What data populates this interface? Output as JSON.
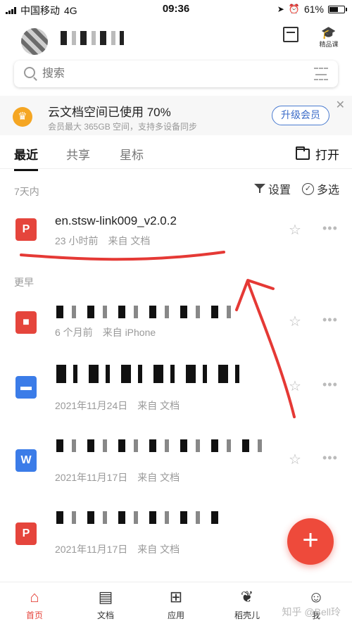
{
  "status_bar": {
    "carrier": "中国移动",
    "network": "4G",
    "time": "09:36",
    "battery_percent": "61%",
    "battery_level": 0.61
  },
  "header": {
    "course_label": "精品课"
  },
  "search": {
    "placeholder": "搜索"
  },
  "banner": {
    "title": "云文档空间已使用 70%",
    "subtitle": "会员最大 365GB 空间，支持多设备同步",
    "upgrade_label": "升级会员",
    "close_glyph": "✕"
  },
  "tabs": [
    {
      "label": "最近"
    },
    {
      "label": "共享"
    },
    {
      "label": "星标"
    }
  ],
  "open_label": "打开",
  "recent_section": {
    "label": "7天内",
    "settings_label": "设置",
    "multiselect_label": "多选"
  },
  "earlier_section": {
    "label": "更早"
  },
  "files": [
    {
      "name": "en.stsw-link009_v2.0.2",
      "time": "23 小时前",
      "source": "来自 文档",
      "icon": "pdf-icon"
    },
    {
      "name": "",
      "time": "6 个月前",
      "source": "来自 iPhone",
      "icon": "doc-icon"
    },
    {
      "name": "",
      "time": "2021年11月24日",
      "source": "来自 文档",
      "icon": "doc-icon"
    },
    {
      "name": "",
      "time": "2021年11月17日",
      "source": "来自 文档",
      "icon": "doc-icon"
    },
    {
      "name": "",
      "time": "2021年11月17日",
      "source": "来自 文档",
      "icon": "pdf-icon"
    }
  ],
  "fab_glyph": "+",
  "bottom_nav": [
    {
      "label": "首页",
      "icon": "home-icon"
    },
    {
      "label": "文档",
      "icon": "document-icon"
    },
    {
      "label": "应用",
      "icon": "apps-icon"
    },
    {
      "label": "稻壳儿",
      "icon": "leaf-icon"
    },
    {
      "label": "我",
      "icon": "person-icon"
    }
  ],
  "watermark": "知乎 @Bell玲",
  "colors": {
    "accent_red": "#e5453c",
    "upgrade_blue": "#3a6bc8",
    "crown_gold": "#f5a623"
  }
}
